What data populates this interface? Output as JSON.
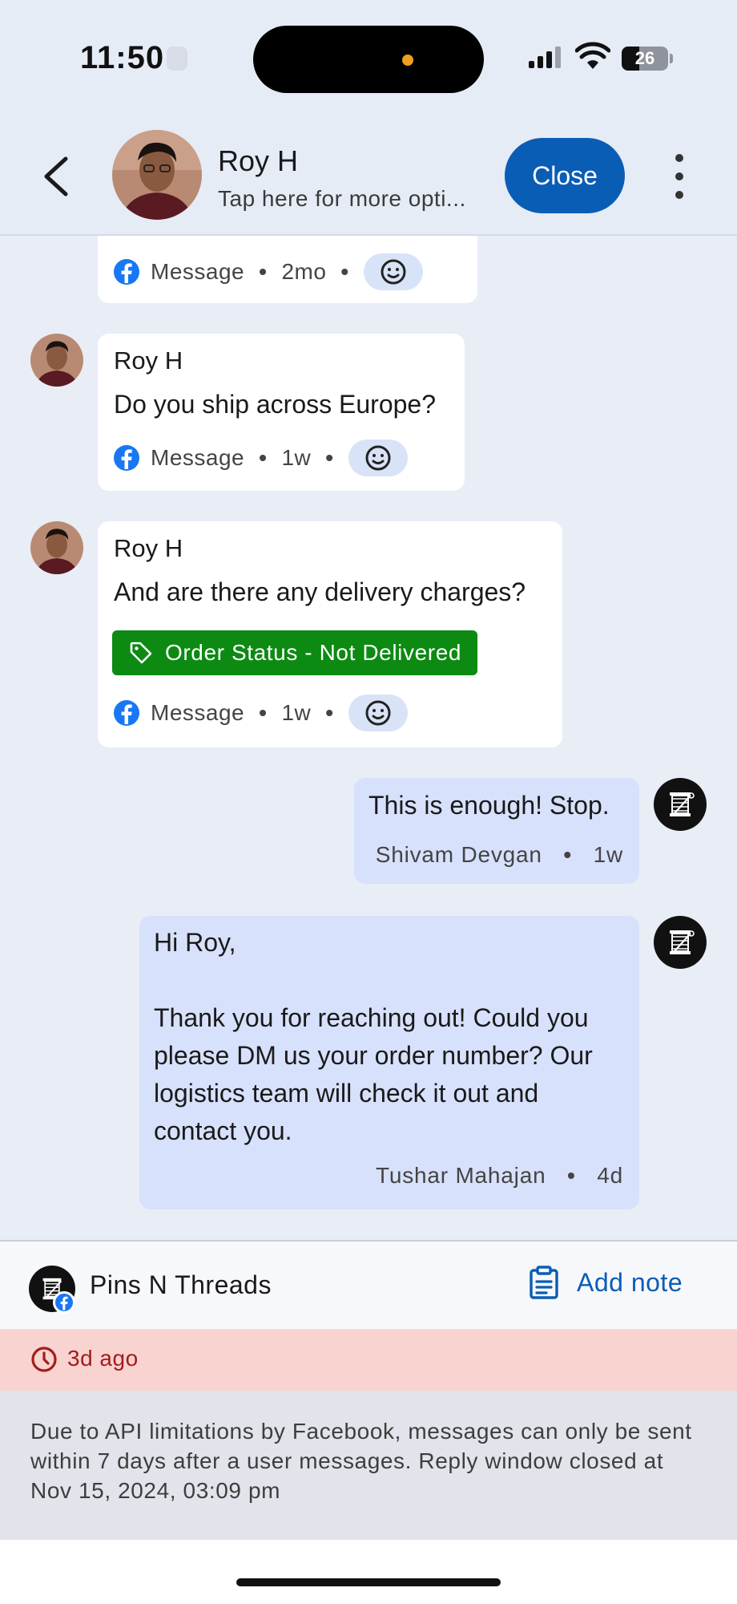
{
  "status_bar": {
    "time": "11:50",
    "battery": "26"
  },
  "header": {
    "back_icon": "chevron-left-icon",
    "contact_name": "Roy H",
    "subtitle": "Tap here for more opti...",
    "close_label": "Close",
    "more_icon": "vertical-ellipsis-icon"
  },
  "messages": [
    {
      "id": "partial",
      "channel": "Message",
      "time": "2mo"
    },
    {
      "id": "m1",
      "sender": "Roy H",
      "text": "Do you ship across Europe?",
      "channel": "Message",
      "time": "1w"
    },
    {
      "id": "m2",
      "sender": "Roy H",
      "text": "And are there any delivery charges?",
      "tag": "Order Status - Not Delivered",
      "channel": "Message",
      "time": "1w"
    },
    {
      "id": "m3",
      "text": "This is enough! Stop.",
      "author": "Shivam Devgan",
      "time": "1w"
    },
    {
      "id": "m4",
      "lines": [
        "Hi Roy,",
        "",
        "Thank you for reaching out! Could you",
        "please DM us your order number? Our",
        "logistics team will check it out and",
        "contact you."
      ],
      "author": "Tushar Mahajan",
      "time": "4d"
    }
  ],
  "page_bar": {
    "page_name": "Pins N Threads",
    "add_note_label": "Add note"
  },
  "warning": {
    "text": "3d ago",
    "color": "#a31c1c"
  },
  "notice": {
    "text": "Due to API limitations by Facebook, messages can only be sent within 7 days after a user messages. Reply window closed at Nov 15, 2024, 03:09 pm"
  },
  "colors": {
    "accent": "#0a5db5",
    "tag_green": "#0c8a12",
    "outgoing_bubble": "#d7e1fb",
    "facebook": "#1877f2"
  }
}
